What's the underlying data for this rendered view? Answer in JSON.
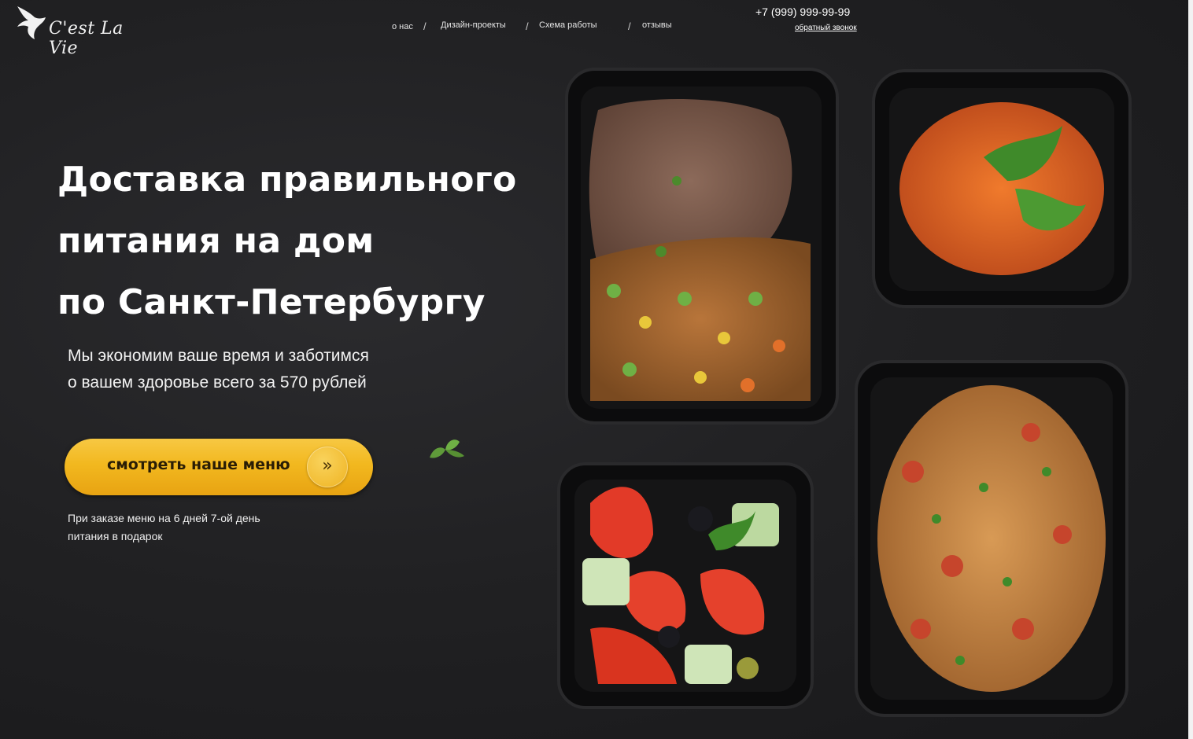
{
  "brand": {
    "logo_text": "C'est La Vie"
  },
  "nav": {
    "items": [
      {
        "label": "о нас"
      },
      {
        "label": "Дизайн-проекты"
      },
      {
        "label": "Схема работы"
      },
      {
        "label": "отзывы"
      }
    ],
    "separator": "/"
  },
  "contact": {
    "phone": "+7 (999) 999-99-99",
    "callback": "обратный звонок"
  },
  "hero": {
    "title_lines": [
      "Доставка правильного",
      "питания на дом",
      "по Санкт-Петербургу"
    ],
    "subtitle_lines": [
      "Мы экономим ваше время и заботимся",
      "о вашем здоровье всего за 570 рублей"
    ],
    "cta_label": "смотреть наше меню",
    "cta_arrow": "»",
    "promo_lines": [
      "При заказе меню на 6 дней 7-ой день",
      "питания в подарок"
    ]
  },
  "colors": {
    "background": "#1e1e20",
    "accent": "#f2b81f",
    "text": "#ffffff"
  },
  "icons": {
    "logo": "dove-icon",
    "leaf": "basil-leaf-icon",
    "cta": "double-chevron-right-icon"
  }
}
